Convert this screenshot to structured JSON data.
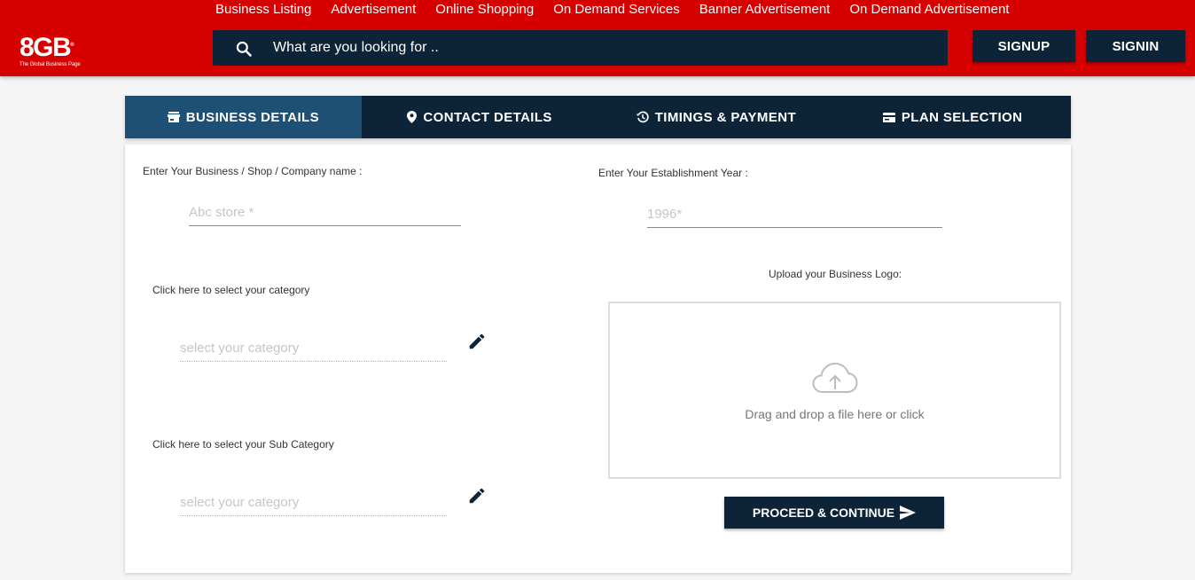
{
  "header": {
    "nav": [
      "Business Listing",
      "Advertisement",
      "Online Shopping",
      "On Demand Services",
      "Banner Advertisement",
      "On Demand Advertisement"
    ],
    "logo_main": "8GB",
    "logo_sub": "The Global Business Page",
    "search_placeholder": "What are you looking for ..",
    "signup_label": "SIGNUP",
    "signin_label": "SIGNIN",
    "brand_color": "#d60000",
    "dark_color": "#0d2438"
  },
  "tabs": [
    {
      "label": "BUSINESS DETAILS",
      "icon": "store-icon",
      "active": true
    },
    {
      "label": "CONTACT DETAILS",
      "icon": "location-pin-icon",
      "active": false
    },
    {
      "label": "TIMINGS & PAYMENT",
      "icon": "history-icon",
      "active": false
    },
    {
      "label": "PLAN SELECTION",
      "icon": "card-icon",
      "active": false
    }
  ],
  "form": {
    "business_name_label": "Enter Your Business / Shop / Company name :",
    "business_name_placeholder": "Abc store *",
    "year_label": "Enter Your Establishment Year :",
    "year_placeholder": "1996*",
    "category_label": "Click here to select your category",
    "category_placeholder": "select your category",
    "subcategory_label": "Click here to select your Sub Category",
    "subcategory_placeholder": "select your category",
    "logo_label": "Upload your Business Logo:",
    "upload_text": "Drag and drop a file here or click",
    "proceed_label": "PROCEED & CONTINUE"
  }
}
